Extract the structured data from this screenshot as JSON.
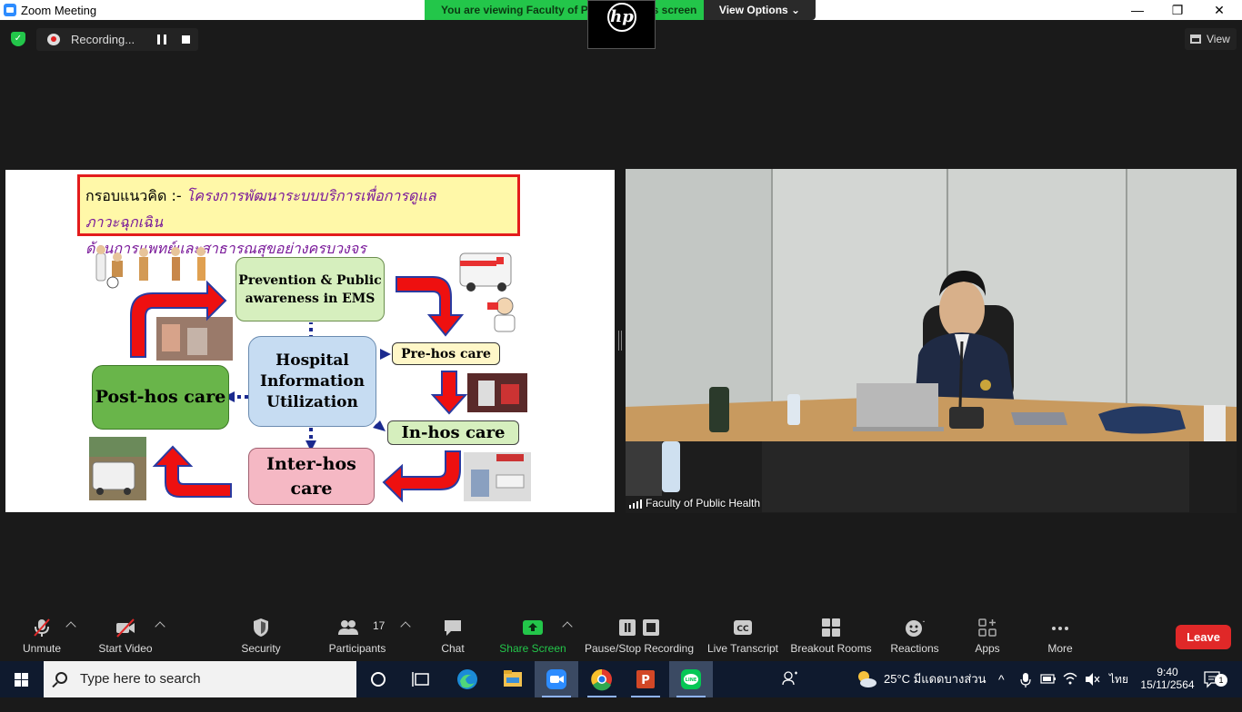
{
  "window": {
    "title": "Zoom Meeting",
    "share_banner": "You are viewing Faculty of Public Health's screen",
    "view_options": "View Options ⌄",
    "minimize": "—",
    "restore": "❐",
    "close": "✕"
  },
  "recording": {
    "label": "Recording...",
    "view_label": "View"
  },
  "slide": {
    "title_lead": "กรอบแนวคิด :-",
    "title_rest_line1": " โครงการพัฒนาระบบบริการเพื่อการดูแลภาวะฉุกเฉิน",
    "title_rest_line2": "ด้านการแพทย์และสาธารณสุขอย่างครบวงจร",
    "nodes": {
      "prevention": "Prevention & Public awareness in EMS",
      "hospital": "Hospital Information Utilization",
      "posthos": "Post-hos care",
      "prehos": "Pre-hos care",
      "inhos": "In-hos care",
      "interhos": "Inter-hos care"
    }
  },
  "video": {
    "participant_name": "Faculty of Public Health"
  },
  "toolbar": {
    "unmute": "Unmute",
    "start_video": "Start Video",
    "security": "Security",
    "participants": "Participants",
    "participants_count": "17",
    "chat": "Chat",
    "share_screen": "Share Screen",
    "pause_stop_recording": "Pause/Stop Recording",
    "live_transcript": "Live Transcript",
    "breakout_rooms": "Breakout Rooms",
    "reactions": "Reactions",
    "apps": "Apps",
    "more": "More",
    "leave": "Leave"
  },
  "taskbar": {
    "search_placeholder": "Type here to search",
    "weather": "25°C มีแดดบางส่วน",
    "language": "ไทย",
    "time": "9:40",
    "date": "15/11/2564",
    "notifications": "1"
  },
  "colors": {
    "zoom_blue": "#2d8cff",
    "share_green": "#23c64a",
    "leave_red": "#e02828"
  }
}
